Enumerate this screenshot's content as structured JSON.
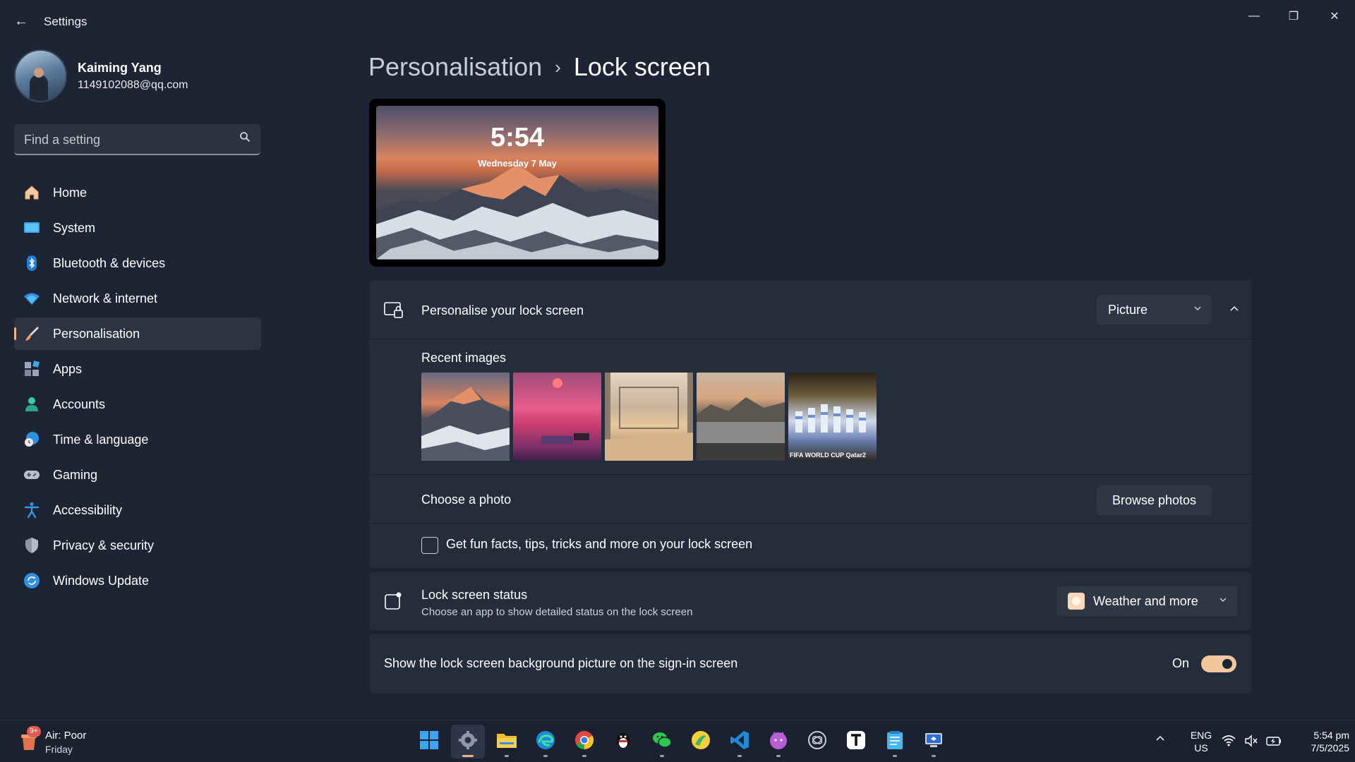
{
  "window": {
    "title": "Settings",
    "back_glyph": "←",
    "minimize_glyph": "—",
    "maximize_glyph": "❐",
    "close_glyph": "✕"
  },
  "user": {
    "name": "Kaiming Yang",
    "email": "1149102088@qq.com"
  },
  "search": {
    "placeholder": "Find a setting",
    "icon": "search-icon"
  },
  "sidebar": {
    "active": "Personalisation",
    "items": [
      {
        "label": "Home",
        "icon": "home-icon"
      },
      {
        "label": "System",
        "icon": "system-icon"
      },
      {
        "label": "Bluetooth & devices",
        "icon": "bluetooth-icon"
      },
      {
        "label": "Network & internet",
        "icon": "wifi-icon"
      },
      {
        "label": "Personalisation",
        "icon": "brush-icon"
      },
      {
        "label": "Apps",
        "icon": "apps-icon"
      },
      {
        "label": "Accounts",
        "icon": "accounts-icon"
      },
      {
        "label": "Time & language",
        "icon": "clock-globe-icon"
      },
      {
        "label": "Gaming",
        "icon": "gamepad-icon"
      },
      {
        "label": "Accessibility",
        "icon": "accessibility-icon"
      },
      {
        "label": "Privacy & security",
        "icon": "shield-icon"
      },
      {
        "label": "Windows Update",
        "icon": "update-icon"
      }
    ]
  },
  "breadcrumb": {
    "parent": "Personalisation",
    "separator": "›",
    "current": "Lock screen"
  },
  "preview": {
    "time": "5:54",
    "date": "Wednesday 7 May"
  },
  "personalise": {
    "title": "Personalise your lock screen",
    "dropdown_value": "Picture",
    "dropdown_chevron": "⌄",
    "collapse_glyph": "︿",
    "recent_images_label": "Recent images",
    "recent_images": [
      {
        "name": "mountain-sunset"
      },
      {
        "name": "pink-clouds-room"
      },
      {
        "name": "sunlit-room-view"
      },
      {
        "name": "lake-mountains"
      },
      {
        "name": "world-cup-celebration",
        "caption": "FIFA WORLD CUP Qatar2"
      }
    ],
    "choose_photo_label": "Choose a photo",
    "browse_button": "Browse photos",
    "fun_facts_label": "Get fun facts, tips, tricks and more on your lock screen",
    "fun_facts_checked": false
  },
  "status": {
    "title": "Lock screen status",
    "subtitle": "Choose an app to show detailed status on the lock screen",
    "dropdown_value": "Weather and more",
    "dropdown_chevron": "⌄"
  },
  "signin": {
    "label": "Show the lock screen background picture on the sign-in screen",
    "state_label": "On",
    "enabled": true
  },
  "taskbar": {
    "widget": {
      "badge": "9+",
      "title": "Air: Poor",
      "subtitle": "Friday"
    },
    "apps": [
      "start-icon",
      "settings-icon",
      "file-explorer-icon",
      "edge-icon",
      "chrome-icon",
      "qq-icon",
      "wechat-icon",
      "app-icon",
      "vscode-icon",
      "cat-app-icon",
      "chatgpt-icon",
      "typora-icon",
      "notepad-icon",
      "remote-desktop-icon"
    ],
    "active_app": "settings-icon",
    "tray_chevron": "︿",
    "lang_line1": "ENG",
    "lang_line2": "US",
    "time": "5:54 pm",
    "date": "7/5/2025"
  },
  "colors": {
    "background": "#1d2434",
    "card": "#252c3b",
    "accent": "#f2b388",
    "toggle_on": "#f2c79d"
  }
}
